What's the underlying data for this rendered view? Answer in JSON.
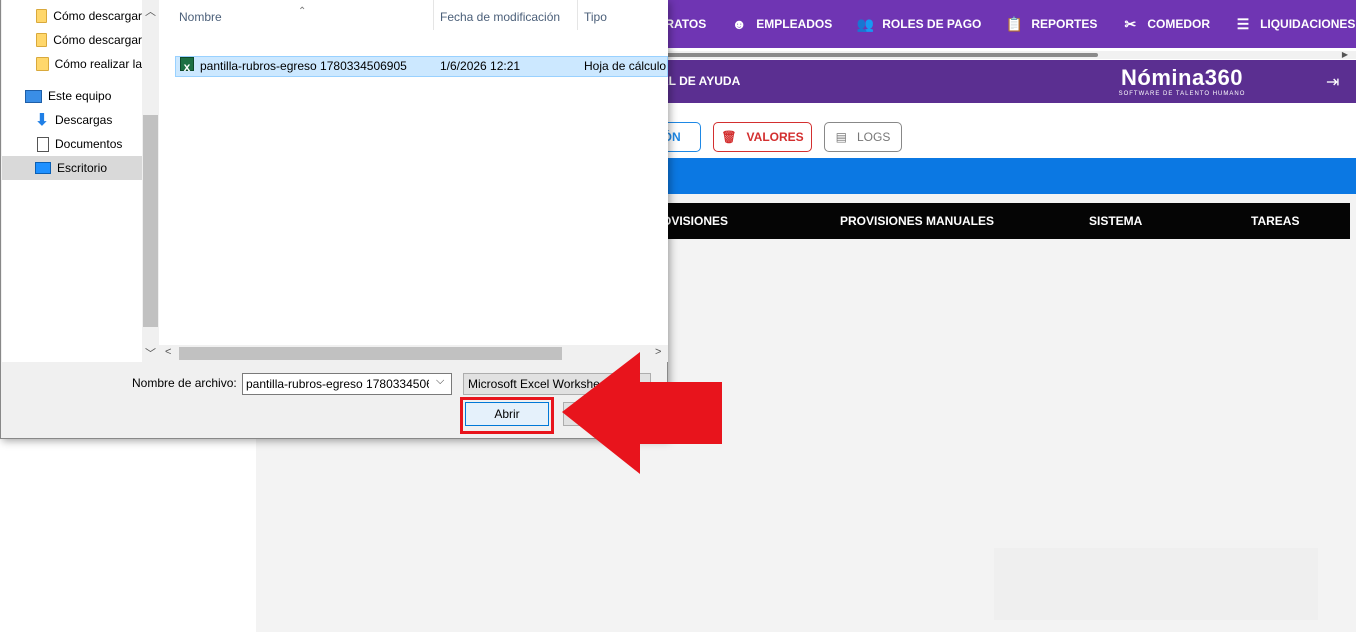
{
  "app": {
    "nav": {
      "items": [
        {
          "label": "ONTRATOS",
          "icon": ""
        },
        {
          "label": "EMPLEADOS",
          "icon": "☻"
        },
        {
          "label": "ROLES DE PAGO",
          "icon": "👥"
        },
        {
          "label": "REPORTES",
          "icon": "📋"
        },
        {
          "label": "COMEDOR",
          "icon": "✂"
        },
        {
          "label": "LIQUIDACIONES",
          "icon": "☰"
        },
        {
          "label": "",
          "icon": "📅"
        }
      ]
    },
    "header": {
      "help_label": "AL DE AYUDA",
      "brand_title": "Nómina360",
      "brand_subtitle": "SOFTWARE DE TALENTO HUMANO",
      "logout_icon": "⇥"
    },
    "actions": {
      "prev_label": "IÓN",
      "valores_label": "VALORES",
      "valores_icon": "🗑",
      "logs_label": "LOGS",
      "logs_icon": "▤"
    },
    "tabs": [
      "OVISIONES",
      "PROVISIONES MANUALES",
      "SISTEMA",
      "TAREAS"
    ]
  },
  "dialog": {
    "nav_pane": [
      {
        "label": "Cómo descargar",
        "icon": "folder-icon"
      },
      {
        "label": "Cómo descargar",
        "icon": "folder-icon"
      },
      {
        "label": "Cómo realizar la",
        "icon": "folder-icon"
      },
      {
        "label": "Este equipo",
        "icon": "computer-icon"
      },
      {
        "label": "Descargas",
        "icon": "download-icon"
      },
      {
        "label": "Documentos",
        "icon": "documents-icon"
      },
      {
        "label": "Escritorio",
        "icon": "desktop-icon"
      }
    ],
    "columns": {
      "name": "Nombre",
      "modified": "Fecha de modificación",
      "type": "Tipo"
    },
    "files": [
      {
        "name": "pantilla-rubros-egreso 1780334506905",
        "modified": "1/6/2026 12:21",
        "type": "Hoja de cálculo"
      }
    ],
    "filename_label": "Nombre de archivo:",
    "filename_value": "pantilla-rubros-egreso 1780334506905",
    "filetype_value": "Microsoft Excel Worksheet",
    "open_label": "Abrir"
  },
  "colors": {
    "nav_bg": "#6f35b3",
    "header_bg": "#5b2f91",
    "arrow_red": "#e8141c",
    "selection": "#cce8ff"
  }
}
